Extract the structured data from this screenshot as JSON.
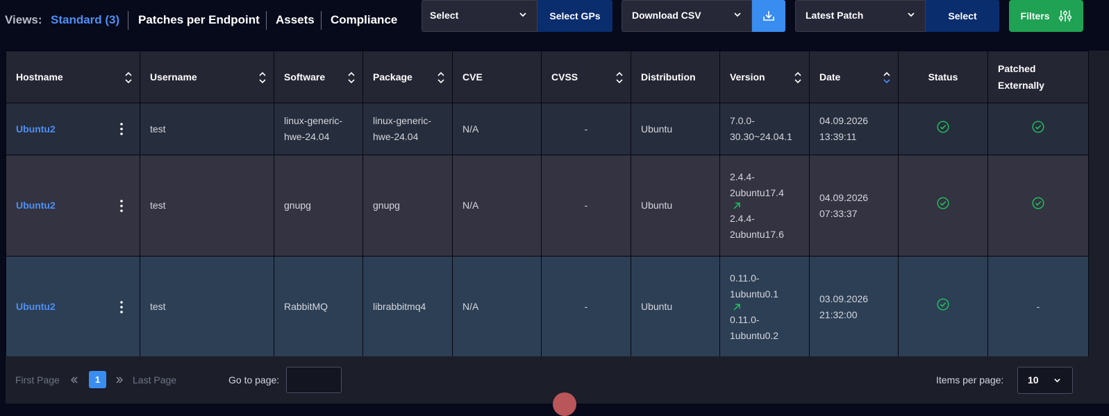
{
  "views": {
    "label": "Views:",
    "tabs": [
      {
        "label": "Standard (3)",
        "active": true
      },
      {
        "label": "Patches per Endpoint",
        "active": false
      },
      {
        "label": "Assets",
        "active": false
      },
      {
        "label": "Compliance",
        "active": false
      }
    ]
  },
  "toolbar": {
    "gp_select_value": "Select",
    "gp_button_label": "Select GPs",
    "download_select_value": "Download CSV",
    "download_icon": "download-icon",
    "patch_select_value": "Latest Patch",
    "patch_button_label": "Select",
    "filters_label": "Filters",
    "filters_icon": "sliders-icon"
  },
  "table": {
    "columns": [
      {
        "label": "Hostname",
        "sortable": true
      },
      {
        "label": "Username",
        "sortable": true
      },
      {
        "label": "Software",
        "sortable": true
      },
      {
        "label": "Package",
        "sortable": true
      },
      {
        "label": "CVE",
        "sortable": false
      },
      {
        "label": "CVSS",
        "sortable": true
      },
      {
        "label": "Distribution",
        "sortable": false
      },
      {
        "label": "Version",
        "sortable": true
      },
      {
        "label": "Date",
        "sortable": true,
        "sort_direction": "desc"
      },
      {
        "label": "Status",
        "sortable": false
      },
      {
        "label": "Patched Externally",
        "sortable": false
      }
    ],
    "rows": [
      {
        "hostname": "Ubuntu2",
        "username": "test",
        "software": "linux-generic-hwe-24.04",
        "package": "linux-generic-hwe-24.04",
        "cve": "N/A",
        "cvss": "-",
        "distribution": "Ubuntu",
        "version_from": "7.0.0-30.30~24.04.1",
        "version_to": "",
        "date": "04.09.2026 13:39:11",
        "status": "check",
        "patched_externally": "check"
      },
      {
        "hostname": "Ubuntu2",
        "username": "test",
        "software": "gnupg",
        "package": "gnupg",
        "cve": "N/A",
        "cvss": "-",
        "distribution": "Ubuntu",
        "version_from": "2.4.4-2ubuntu17.4",
        "version_to": "2.4.4-2ubuntu17.6",
        "date": "04.09.2026 07:33:37",
        "status": "check",
        "patched_externally": "check"
      },
      {
        "hostname": "Ubuntu2",
        "username": "test",
        "software": "RabbitMQ",
        "package": "librabbitmq4",
        "cve": "N/A",
        "cvss": "-",
        "distribution": "Ubuntu",
        "version_from": "0.11.0-1ubuntu0.1",
        "version_to": "0.11.0-1ubuntu0.2",
        "date": "03.09.2026 21:32:00",
        "status": "check",
        "patched_externally": "-"
      }
    ]
  },
  "pagination": {
    "first_label": "First Page",
    "current_page": "1",
    "last_label": "Last Page",
    "goto_label": "Go to page:",
    "goto_value": "",
    "items_per_page_label": "Items per page:",
    "items_per_page_value": "10"
  },
  "colors": {
    "accent_blue": "#4d8ff5",
    "navy_button": "#0a2d6e",
    "green_button": "#1fa253",
    "status_check": "#22c55e"
  }
}
